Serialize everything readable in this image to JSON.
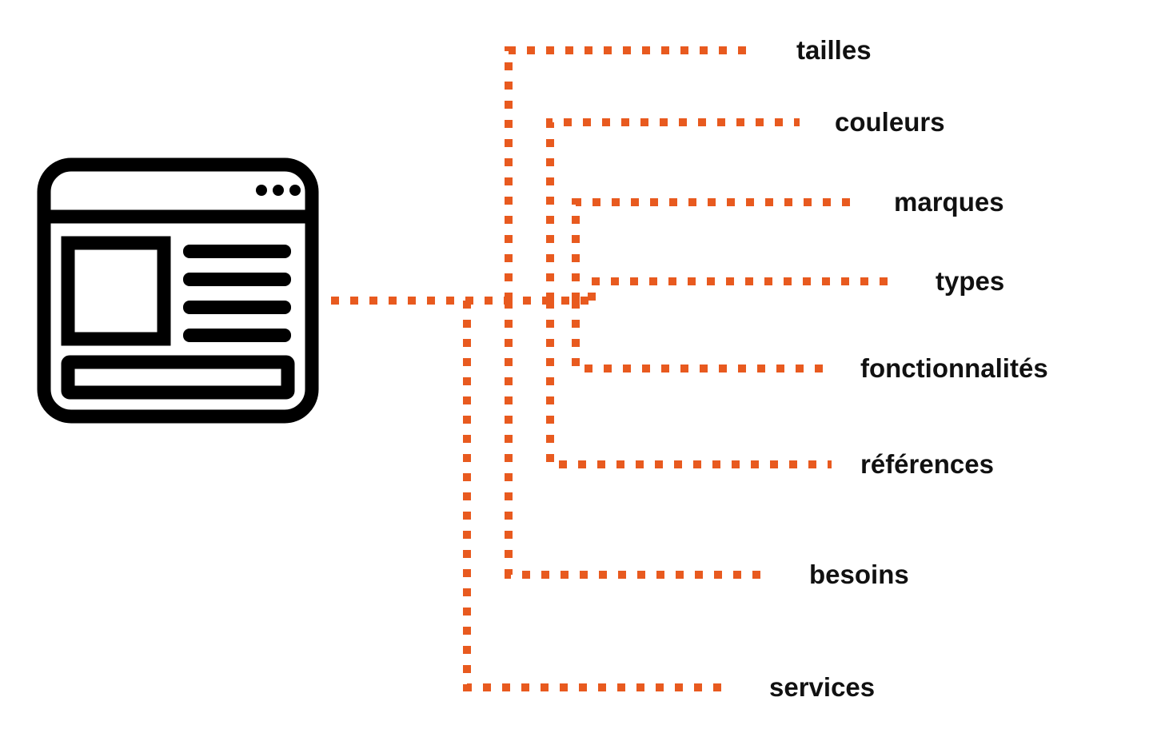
{
  "colors": {
    "dotted": "#E85A1F",
    "icon": "#000000",
    "text": "#111111"
  },
  "labels": [
    "tailles",
    "couleurs",
    "marques",
    "types",
    "fonctionnalités",
    "références",
    "besoins",
    "services"
  ]
}
